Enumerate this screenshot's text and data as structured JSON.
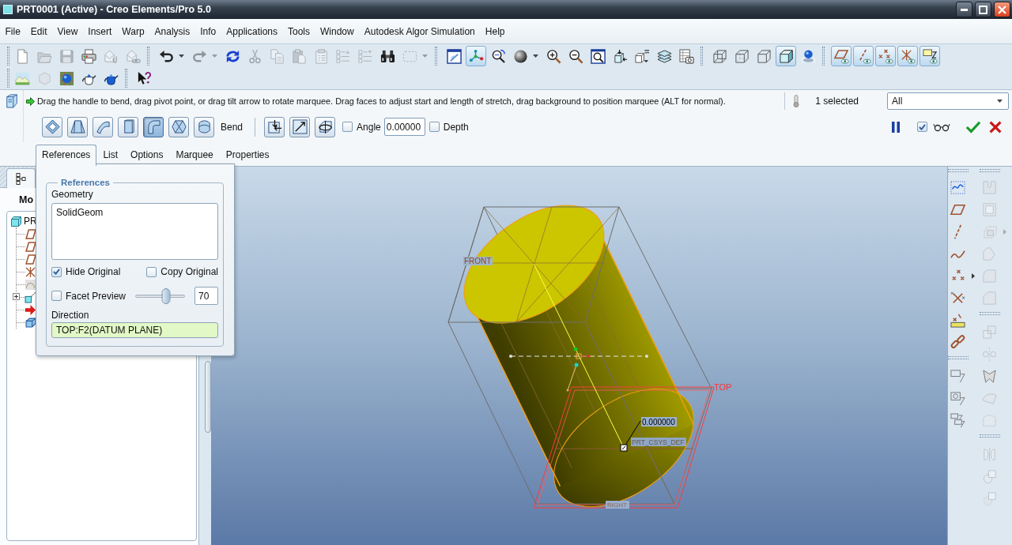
{
  "window": {
    "title": "PRT0001 (Active) - Creo Elements/Pro 5.0"
  },
  "menu": [
    "File",
    "Edit",
    "View",
    "Insert",
    "Warp",
    "Analysis",
    "Info",
    "Applications",
    "Tools",
    "Window",
    "Autodesk Algor Simulation",
    "Help"
  ],
  "toolbar": [
    [
      [
        {
          "kind": "new",
          "disabled": false,
          "on": false,
          "dropdown": false
        },
        {
          "kind": "open",
          "disabled": true,
          "on": false,
          "dropdown": false
        },
        {
          "kind": "save",
          "disabled": true,
          "on": false,
          "dropdown": false
        },
        {
          "kind": "print",
          "disabled": false,
          "on": false,
          "dropdown": false
        },
        {
          "kind": "mail",
          "disabled": true,
          "on": false,
          "dropdown": false
        },
        {
          "kind": "link",
          "disabled": true,
          "on": false,
          "dropdown": false
        }
      ],
      [
        {
          "kind": "undo",
          "disabled": false,
          "on": false,
          "dropdown": true
        },
        {
          "kind": "redo",
          "disabled": true,
          "on": false,
          "dropdown": true
        },
        {
          "kind": "regenerate",
          "disabled": false,
          "on": false,
          "dropdown": false
        },
        {
          "kind": "cut",
          "disabled": true,
          "on": false,
          "dropdown": false
        },
        {
          "kind": "copy",
          "disabled": true,
          "on": false,
          "dropdown": false
        },
        {
          "kind": "paste",
          "disabled": true,
          "on": false,
          "dropdown": false
        },
        {
          "kind": "pastespecial",
          "disabled": true,
          "on": false,
          "dropdown": false
        },
        {
          "kind": "listup",
          "disabled": true,
          "on": false,
          "dropdown": false
        },
        {
          "kind": "listdown",
          "disabled": true,
          "on": false,
          "dropdown": false
        },
        {
          "kind": "find",
          "disabled": false,
          "on": false,
          "dropdown": false
        },
        {
          "kind": "selbox",
          "disabled": true,
          "on": false,
          "dropdown": true
        }
      ],
      [
        {
          "kind": "repaint",
          "disabled": false,
          "on": false,
          "dropdown": false
        },
        {
          "kind": "spin",
          "disabled": false,
          "on": true,
          "dropdown": false
        },
        {
          "kind": "orient",
          "disabled": false,
          "on": false,
          "dropdown": false
        },
        {
          "kind": "shade",
          "disabled": false,
          "on": false,
          "dropdown": true
        },
        {
          "kind": "zoomin",
          "disabled": false,
          "on": false,
          "dropdown": false
        },
        {
          "kind": "zoomout",
          "disabled": false,
          "on": false,
          "dropdown": false
        },
        {
          "kind": "refit",
          "disabled": false,
          "on": false,
          "dropdown": false
        },
        {
          "kind": "reorient",
          "disabled": false,
          "on": false,
          "dropdown": false
        },
        {
          "kind": "views",
          "disabled": false,
          "on": false,
          "dropdown": false
        },
        {
          "kind": "layers",
          "disabled": false,
          "on": false,
          "dropdown": false
        },
        {
          "kind": "viewmgr",
          "disabled": false,
          "on": false,
          "dropdown": false
        }
      ],
      [
        {
          "kind": "wire",
          "disabled": false,
          "on": false,
          "dropdown": false
        },
        {
          "kind": "hidden",
          "disabled": false,
          "on": false,
          "dropdown": false
        },
        {
          "kind": "nohidden",
          "disabled": false,
          "on": false,
          "dropdown": false
        },
        {
          "kind": "shading",
          "disabled": false,
          "on": true,
          "dropdown": false
        },
        {
          "kind": "realism",
          "disabled": false,
          "on": false,
          "dropdown": false
        }
      ],
      [
        {
          "kind": "planes",
          "disabled": false,
          "on": true,
          "dropdown": false
        },
        {
          "kind": "axes",
          "disabled": false,
          "on": true,
          "dropdown": false
        },
        {
          "kind": "points",
          "disabled": false,
          "on": true,
          "dropdown": false
        },
        {
          "kind": "csys",
          "disabled": false,
          "on": true,
          "dropdown": false
        },
        {
          "kind": "notes",
          "disabled": false,
          "on": true,
          "dropdown": false
        }
      ]
    ],
    [
      [
        {
          "kind": "appearance",
          "disabled": false,
          "on": false,
          "dropdown": false
        },
        {
          "kind": "model",
          "disabled": true,
          "on": false,
          "dropdown": false
        },
        {
          "kind": "texture",
          "disabled": false,
          "on": false,
          "dropdown": false
        },
        {
          "kind": "teapot",
          "disabled": false,
          "on": false,
          "dropdown": false
        },
        {
          "kind": "teapotblue",
          "disabled": false,
          "on": false,
          "dropdown": false
        }
      ],
      [
        {
          "kind": "help",
          "disabled": false,
          "on": false,
          "dropdown": false
        }
      ]
    ]
  ],
  "dashboard": {
    "message": "Drag the handle to bend, drag pivot point, or drag tilt arrow to rotate marquee. Drag faces to adjust start and length of stretch, drag background to position marquee (ALT for normal).",
    "selection_count": "1 selected",
    "filter": "All",
    "modes": [
      {
        "kind": "transform",
        "selected": false
      },
      {
        "kind": "warp",
        "selected": false
      },
      {
        "kind": "spine",
        "selected": false
      },
      {
        "kind": "stretch",
        "selected": false
      },
      {
        "kind": "bend",
        "selected": true
      },
      {
        "kind": "twist",
        "selected": false
      },
      {
        "kind": "sculpt",
        "selected": false
      }
    ],
    "mode_label": "Bend",
    "angle": {
      "label": "Angle",
      "checked": false,
      "value": "0.00000"
    },
    "depth": {
      "label": "Depth",
      "checked": false
    },
    "preview_checked": true,
    "tabs": [
      {
        "label": "References",
        "selected": true
      },
      {
        "label": "List",
        "selected": false
      },
      {
        "label": "Options",
        "selected": false
      },
      {
        "label": "Marquee",
        "selected": false
      },
      {
        "label": "Properties",
        "selected": false
      }
    ]
  },
  "references_panel": {
    "title": "References",
    "geometry_label": "Geometry",
    "geometry_items": [
      "SolidGeom"
    ],
    "hide_original": {
      "label": "Hide Original",
      "checked": true
    },
    "copy_original": {
      "label": "Copy Original",
      "checked": false
    },
    "facet_preview": {
      "label": "Facet Preview",
      "checked": false,
      "level": 0.63,
      "value": "70"
    },
    "direction_label": "Direction",
    "direction_value": "TOP:F2(DATUM PLANE)"
  },
  "model_tree": {
    "heading": "Mo",
    "root": "PR",
    "items": [
      {
        "kind": "plane"
      },
      {
        "kind": "plane"
      },
      {
        "kind": "plane"
      },
      {
        "kind": "csys"
      },
      {
        "kind": "sketch"
      },
      {
        "kind": "feature",
        "expanded": false
      },
      {
        "kind": "insert"
      },
      {
        "kind": "warp"
      }
    ]
  },
  "viewport": {
    "front_label": "FRONT",
    "top_label": "TOP",
    "right_label": "RIGHT",
    "csys_label": "PRT_CSYS_DEF",
    "dimension": "0.000000"
  },
  "side_toolbar": [
    [
      [
        {
          "kind": "sketch",
          "disabled": false,
          "flyout": false
        },
        {
          "kind": "plane",
          "disabled": false,
          "flyout": false
        },
        {
          "kind": "axis",
          "disabled": false,
          "flyout": false
        },
        {
          "kind": "curve",
          "disabled": false,
          "flyout": false
        },
        {
          "kind": "point",
          "disabled": false,
          "flyout": true
        },
        {
          "kind": "csys",
          "disabled": false,
          "flyout": false
        },
        {
          "kind": "analysis",
          "disabled": false,
          "flyout": false
        },
        {
          "kind": "chain",
          "disabled": false,
          "flyout": false
        }
      ],
      [
        {
          "kind": "note",
          "disabled": false,
          "flyout": false
        },
        {
          "kind": "note2",
          "disabled": false,
          "flyout": false
        },
        {
          "kind": "note3",
          "disabled": false,
          "flyout": false
        }
      ]
    ],
    [
      [
        {
          "kind": "hole",
          "disabled": true,
          "flyout": false
        },
        {
          "kind": "shell",
          "disabled": true,
          "flyout": false
        },
        {
          "kind": "rib",
          "disabled": true,
          "flyout": true
        },
        {
          "kind": "draft",
          "disabled": true,
          "flyout": false
        },
        {
          "kind": "round",
          "disabled": true,
          "flyout": false
        },
        {
          "kind": "chamfer",
          "disabled": true,
          "flyout": false
        }
      ],
      [
        {
          "kind": "pattern",
          "disabled": true,
          "flyout": false
        },
        {
          "kind": "mirror",
          "disabled": true,
          "flyout": false
        },
        {
          "kind": "warp",
          "disabled": false,
          "flyout": false
        },
        {
          "kind": "boundary",
          "disabled": true,
          "flyout": false
        },
        {
          "kind": "fill",
          "disabled": true,
          "flyout": false
        }
      ],
      [
        {
          "kind": "merge",
          "disabled": true,
          "flyout": false
        },
        {
          "kind": "intersect",
          "disabled": true,
          "flyout": false
        },
        {
          "kind": "solidify",
          "disabled": true,
          "flyout": false
        }
      ]
    ]
  ]
}
